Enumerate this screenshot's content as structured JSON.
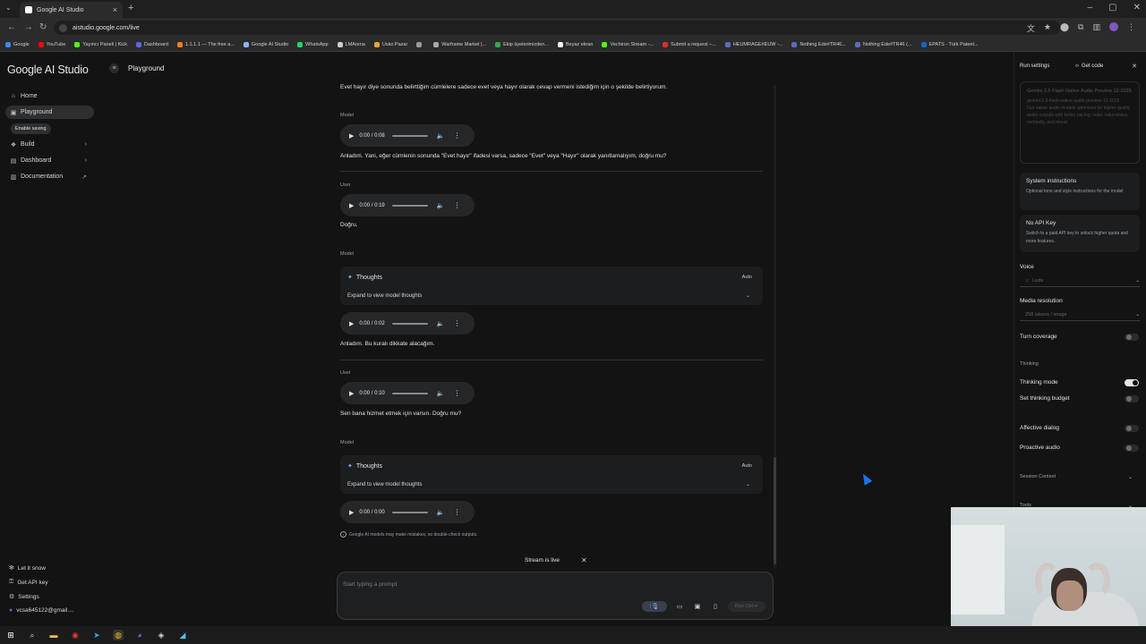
{
  "browser": {
    "tab_title": "Google AI Studio",
    "url": "aistudio.google.com/live",
    "bookmarks": [
      {
        "label": "Google",
        "color": "#4285f4"
      },
      {
        "label": "YouTube",
        "color": "#ff0000"
      },
      {
        "label": "Yayıncı Paneli | Kick",
        "color": "#53fc18"
      },
      {
        "label": "Dashboard",
        "color": "#5865f2"
      },
      {
        "label": "1.1.1.1 — The free a...",
        "color": "#f38020"
      },
      {
        "label": "Google AI Studio",
        "color": "#8ab4f8"
      },
      {
        "label": "WhatsApp",
        "color": "#25d366"
      },
      {
        "label": "LMArena",
        "color": "#cccccc"
      },
      {
        "label": "Usko Pazar",
        "color": "#e8a33d"
      },
      {
        "label": "",
        "color": "#999999"
      },
      {
        "label": "Warframe Market |...",
        "color": "#aaaaaa"
      },
      {
        "label": "Ekip üyelerimizden...",
        "color": "#34a853"
      },
      {
        "label": "Beyaz ekran",
        "color": "#ffffff"
      },
      {
        "label": "Vechiron Stream -...",
        "color": "#53fc18"
      },
      {
        "label": "Submit a request –...",
        "color": "#d93025"
      },
      {
        "label": "HEUMRAGE#EUW -...",
        "color": "#5c6bc0"
      },
      {
        "label": "Nothing Ede#TR46...",
        "color": "#5c6bc0"
      },
      {
        "label": "Nothing Ede#TR46 (...",
        "color": "#5c6bc0"
      },
      {
        "label": "EPATS - Türk Patent...",
        "color": "#1565c0"
      }
    ]
  },
  "sidebar": {
    "brand": "Google AI Studio",
    "nav": [
      {
        "label": "Home",
        "icon": "home-icon",
        "glyph": "⌂"
      },
      {
        "label": "Playground",
        "icon": "playground-icon",
        "glyph": "▣"
      },
      {
        "label": "Build",
        "icon": "build-icon",
        "glyph": "❖"
      },
      {
        "label": "Dashboard",
        "icon": "dashboard-icon",
        "glyph": "▤"
      },
      {
        "label": "Documentation",
        "icon": "documentation-icon",
        "glyph": "▥"
      }
    ],
    "enable_saving": "Enable saving",
    "bottom": [
      {
        "label": "Let it snow",
        "glyph": "✻"
      },
      {
        "label": "Get API key",
        "glyph": "⚿"
      },
      {
        "label": "Settings",
        "glyph": "⚙"
      },
      {
        "label": "vcsa645122@gmail....",
        "glyph": "●"
      }
    ]
  },
  "header": {
    "title": "Playground"
  },
  "chat": {
    "messages": [
      {
        "text": "Evet hayır diye sonunda belirttiğim cümlelere sadece evet veya hayır olarak cevap vermeni istediğim için o şekilde belirtiyorum."
      },
      {
        "role": "Model",
        "audio": "0:00 / 0:08",
        "text": "Anladım. Yani, eğer cümlenin sonunda \"Evet hayır\" ifadesi varsa, sadece \"Evet\" veya \"Hayır\" olarak yanıtlamalıyım, doğru mu?"
      },
      {
        "role": "User",
        "audio": "0:00 / 0:19",
        "text": "Doğru."
      },
      {
        "role": "Model",
        "thoughts_title": "Thoughts",
        "thoughts_mode": "Auto",
        "thoughts_expand": "Expand to view model thoughts",
        "audio": "0:00 / 0:02",
        "text": "Anladım. Bu kuralı dikkate alacağım."
      },
      {
        "role": "User",
        "audio": "0:00 / 0:10",
        "text": "Sen bana hizmet etmek için varsın. Doğru mu?"
      },
      {
        "role": "Model",
        "thoughts_title": "Thoughts",
        "thoughts_mode": "Auto",
        "thoughts_expand": "Expand to view model thoughts",
        "audio": "0:00 / 0:00"
      }
    ],
    "disclaimer": "Google AI models may make mistakes, so double-check outputs.",
    "stream_status": "Stream is live",
    "prompt_placeholder": "Start typing a prompt",
    "run_label": "Run Ctrl ↵"
  },
  "settings": {
    "title": "Run settings",
    "get_code": "Get code",
    "model_name": "Gemini 2.5 Flash Native Audio Preview 12-2025",
    "model_id": "gemini-2.5-flash-native-audio-preview-12-2025",
    "model_desc": "Our native audio models optimized for higher quality audio outputs with better pacing, voice naturalness, verbosity, and mood.",
    "system_title": "System instructions",
    "system_desc": "Optional tone and style instructions for the model",
    "apikey_title": "No API Key",
    "apikey_desc": "Switch to a paid API key to unlock higher quota and more features.",
    "voice_label": "Voice",
    "voice_value": "Leda",
    "media_label": "Media resolution",
    "media_value": "258 tokens / image",
    "turn_coverage": "Turn coverage",
    "thinking_header": "Thinking",
    "thinking_mode": "Thinking mode",
    "thinking_budget": "Set thinking budget",
    "affective": "Affective dialog",
    "proactive": "Proactive audio",
    "session_context": "Session Context",
    "tools": "Tools"
  }
}
